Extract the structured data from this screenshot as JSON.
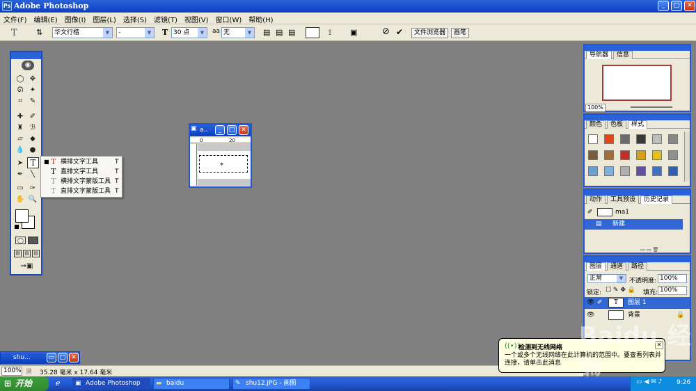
{
  "window": {
    "title": "Adobe Photoshop",
    "app_icon_text": "Ps",
    "controls": {
      "min": "_",
      "max": "□",
      "close": "✕"
    }
  },
  "menubar": [
    "文件(F)",
    "编辑(E)",
    "图像(I)",
    "图层(L)",
    "选择(S)",
    "滤镜(T)",
    "视图(V)",
    "窗口(W)",
    "帮助(H)"
  ],
  "options": {
    "tool_glyph": "T",
    "font_family": "华文行楷",
    "font_style": "-",
    "font_size": "30 点",
    "antialias_label": "aa",
    "antialias": "无",
    "cancel_glyph": "⊘",
    "commit_glyph": "✔",
    "tabs": [
      "文件浏览器",
      "画笔"
    ]
  },
  "flyout": {
    "items": [
      {
        "label": "横排文字工具",
        "key": "T",
        "selected": true
      },
      {
        "label": "直排文字工具",
        "key": "T",
        "selected": false
      },
      {
        "label": "横排文字蒙版工具",
        "key": "T",
        "selected": false
      },
      {
        "label": "直排文字蒙版工具",
        "key": "T",
        "selected": false
      }
    ],
    "selected_mark": "■",
    "icon_glyph": "T"
  },
  "document": {
    "title": "a..",
    "ruler_marks": [
      "0",
      "20"
    ]
  },
  "navigator": {
    "tabs": [
      "导航器",
      "信息"
    ],
    "zoom": "100%"
  },
  "styles_panel": {
    "tabs": [
      "颜色",
      "色板",
      "样式"
    ]
  },
  "history_panel": {
    "tabs": [
      "动作",
      "工具预设",
      "历史记录"
    ],
    "snapshot": "ma1",
    "states": [
      "新建"
    ]
  },
  "layers_panel": {
    "tabs": [
      "图层",
      "通道",
      "路径"
    ],
    "blend_mode": "正常",
    "opacity_label": "不透明度:",
    "opacity": "100%",
    "lock_label": "锁定:",
    "fill_label": "填充:",
    "fill": "100%",
    "layers": [
      {
        "name": "图层 1",
        "type": "text",
        "selected": true
      },
      {
        "name": "背景",
        "type": "background",
        "selected": false
      }
    ]
  },
  "statusbar": {
    "zoom": "100%",
    "info": "35.28 毫米 x 17.64 毫米"
  },
  "minimized_doc": {
    "title": "shu..."
  },
  "balloon": {
    "title": "检测到无线网络",
    "text": "一个或多个无线网络在此计算机的范围中。要查看列表并连接，请单击此消息"
  },
  "taskbar": {
    "start": "开始",
    "items": [
      {
        "label": "Adobe Photoshop",
        "active": true
      },
      {
        "label": "baidu",
        "active": false
      },
      {
        "label": "shu12.JPG - 画图",
        "active": false
      }
    ],
    "clock": "9:26"
  },
  "watermark": "Baidu 经验"
}
